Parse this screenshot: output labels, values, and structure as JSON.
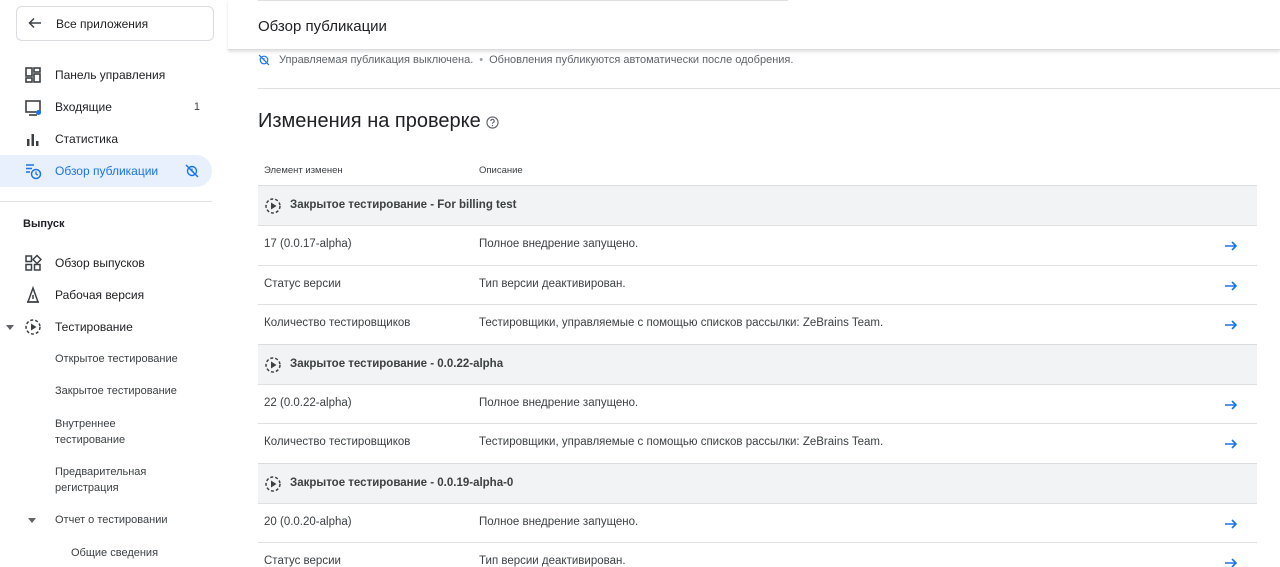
{
  "sidebar": {
    "back_label": "Все приложения",
    "nav": [
      {
        "label": "Панель управления",
        "icon": "dashboard-icon"
      },
      {
        "label": "Входящие",
        "icon": "inbox-icon",
        "badge": "1"
      },
      {
        "label": "Статистика",
        "icon": "bar-chart-icon"
      },
      {
        "label": "Обзор публикации",
        "icon": "publishing-overview-icon",
        "active": true
      }
    ],
    "release_section": "Выпуск",
    "release_items": [
      {
        "label": "Обзор выпусков",
        "icon": "release-overview-icon"
      },
      {
        "label": "Рабочая версия",
        "icon": "production-icon"
      },
      {
        "label": "Тестирование",
        "icon": "testing-icon"
      }
    ],
    "testing_sub": [
      "Открытое тестирование",
      "Закрытое тестирование",
      "Внутреннее тестирование",
      "Предварительная регистрация",
      "Отчет о тестировании",
      "Общие сведения"
    ]
  },
  "header": {
    "title": "Обзор публикации",
    "status_main": "Управляемая публикация выключена.",
    "status_detail": "Обновления публикуются автоматически после одобрения."
  },
  "changes": {
    "heading": "Изменения на проверке",
    "col_element": "Элемент изменен",
    "col_description": "Описание",
    "groups": [
      {
        "title": "Закрытое тестирование - For billing test",
        "rows": [
          {
            "element": "17 (0.0.17-alpha)",
            "description": "Полное внедрение запущено."
          },
          {
            "element": "Статус версии",
            "description": "Тип версии деактивирован."
          },
          {
            "element": "Количество тестировщиков",
            "description": "Тестировщики, управляемые с помощью списков рассылки: ZeBrains Team."
          }
        ]
      },
      {
        "title": "Закрытое тестирование - 0.0.22-alpha",
        "rows": [
          {
            "element": "22 (0.0.22-alpha)",
            "description": "Полное внедрение запущено."
          },
          {
            "element": "Количество тестировщиков",
            "description": "Тестировщики, управляемые с помощью списков рассылки: ZeBrains Team."
          }
        ]
      },
      {
        "title": "Закрытое тестирование - 0.0.19-alpha-0",
        "rows": [
          {
            "element": "20 (0.0.20-alpha)",
            "description": "Полное внедрение запущено."
          },
          {
            "element": "Статус версии",
            "description": "Тип версии деактивирован."
          }
        ]
      }
    ]
  },
  "colors": {
    "accent": "#1a73e8",
    "active_bg": "#e8f0fe",
    "group_bg": "#f1f3f4"
  }
}
